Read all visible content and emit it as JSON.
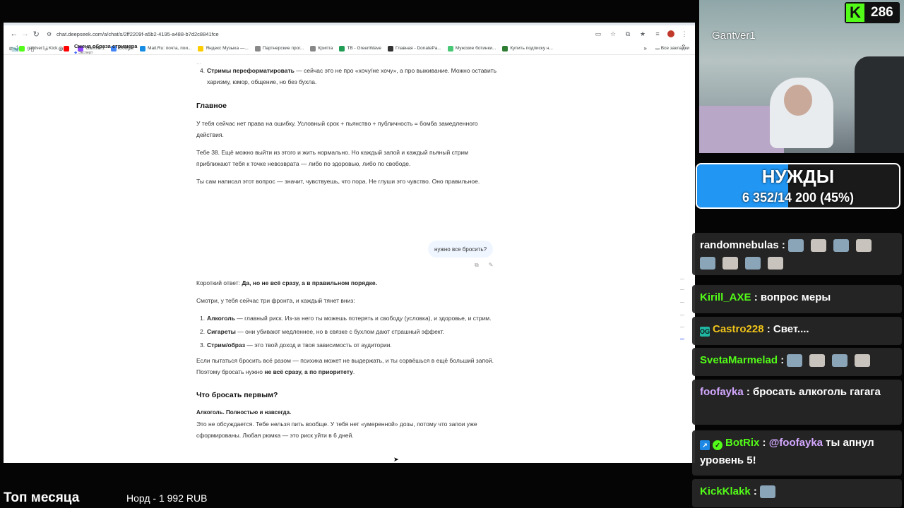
{
  "browser": {
    "url": "chat.deepseek.com/a/chat/s/2ff2209f-a5b2-4195-a488-b7d2c8841fce",
    "bookmarks": [
      {
        "label": "gantver1 | Kick",
        "color": "#53fc18"
      },
      {
        "label": "",
        "color": "#ff0000"
      },
      {
        "label": "Gantver1",
        "color": "#9146ff"
      },
      {
        "label": "Google",
        "color": "#4285f4"
      },
      {
        "label": "Mail.Ru: почта, пои...",
        "color": "#168de2"
      },
      {
        "label": "Яндекс Музыка —...",
        "color": "#ffcc00"
      },
      {
        "label": "Партнерские прог...",
        "color": "#888888"
      },
      {
        "label": "Криптa",
        "color": "#888888"
      },
      {
        "label": "TB - GreenWave",
        "color": "#1f9d55"
      },
      {
        "label": "Главная - DonatePa...",
        "color": "#333333"
      },
      {
        "label": "Мужские ботинки...",
        "color": "#48c774"
      },
      {
        "label": "Купить подписку н...",
        "color": "#2e7d32"
      }
    ],
    "all_bookmarks": "Все закладки"
  },
  "app": {
    "chat_title": "Смена образа стримера",
    "chat_subtitle": "Эксперт"
  },
  "content": {
    "item4_bold": "Стримы переформатировать",
    "item4_text": " — сейчас это не про «хочу/не хочу», а про выживание. Можно оставить харизму, юмор, общение, но без бухла.",
    "h_main": "Главное",
    "p1": "У тебя сейчас нет права на ошибку. Условный срок + пьянство + публичность = бомба замедленного действия.",
    "p2": "Тебе 38. Ещё можно выйти из этого и жить нормально. Но каждый запой и каждый пьяный стрим приближают тебя к точке невозврата — либо по здоровью, либо по свободе.",
    "p3": "Ты сам написал этот вопрос — значит, чувствуешь, что пора. Не глуши это чувство. Оно правильное.",
    "user_msg": "нужно все бросить?",
    "short_prefix": "Короткий ответ: ",
    "short_bold": "Да, но не всё сразу, а в правильном порядке.",
    "p4": "Смотри, у тебя сейчас три фронта, и каждый тянет вниз:",
    "list": [
      {
        "n": "1.",
        "bold": "Алкоголь",
        "text": " — главный риск. Из-за него ты можешь потерять и свободу (условка), и здоровье, и стрим."
      },
      {
        "n": "2.",
        "bold": "Сигареты",
        "text": " — они убивают медленнее, но в связке с бухлом дают страшный эффект."
      },
      {
        "n": "3.",
        "bold": "Стрим/образ",
        "text": " — это твой доход и твоя зависимость от аудитории."
      }
    ],
    "p5_text": "Если пытаться бросить всё разом — психика может не выдержать, и ты сорвёшься в ещё больший запой. Поэтому бросать нужно ",
    "p5_bold": "не всё сразу, а по приоритету",
    "p5_end": ".",
    "h_first": "Что бросать первым?",
    "alc_bold": "Алкоголь. Полностью и навсегда.",
    "p6": "Это не обсуждается. Тебе нельзя пить вообще. У тебя нет «умеренной» дозы, потому что запои уже сформированы. Любая рюмка — это риск уйти в 6 дней."
  },
  "overlay": {
    "cam_name": "Gantver1",
    "viewer_count": "286",
    "goal_title": "НУЖДЫ",
    "goal_progress": "6 352/14 200 (45%)",
    "goal_fraction": 0.45,
    "bottom_title": "Топ месяца",
    "bottom_donor": "Норд - 1 992 RUB"
  },
  "chat": [
    {
      "user": "randomnebulas",
      "color": "#ffffff",
      "text": "",
      "emotes": 8
    },
    {
      "user": "Kirill_AXE",
      "color": "#53fc18",
      "text": "вопрос меры",
      "emotes": 0
    },
    {
      "user": "Castro228",
      "color": "#f0c419",
      "text": "Свет....",
      "emotes": 0,
      "badge": "OG"
    },
    {
      "user": "SvetaMarmelad",
      "color": "#53fc18",
      "text": "",
      "emotes": 4
    },
    {
      "user": "foofayka",
      "color": "#d3a8ff",
      "text": "бросать алкоголь гагага",
      "emotes": 0
    },
    {
      "user": "BotRix",
      "color": "#53fc18",
      "mention": "@foofayka",
      "text": "ты апнул уровень 5!",
      "emotes": 0,
      "badge": "bot"
    },
    {
      "user": "KickKlakk",
      "color": "#53fc18",
      "text": "",
      "emotes": 1
    }
  ]
}
